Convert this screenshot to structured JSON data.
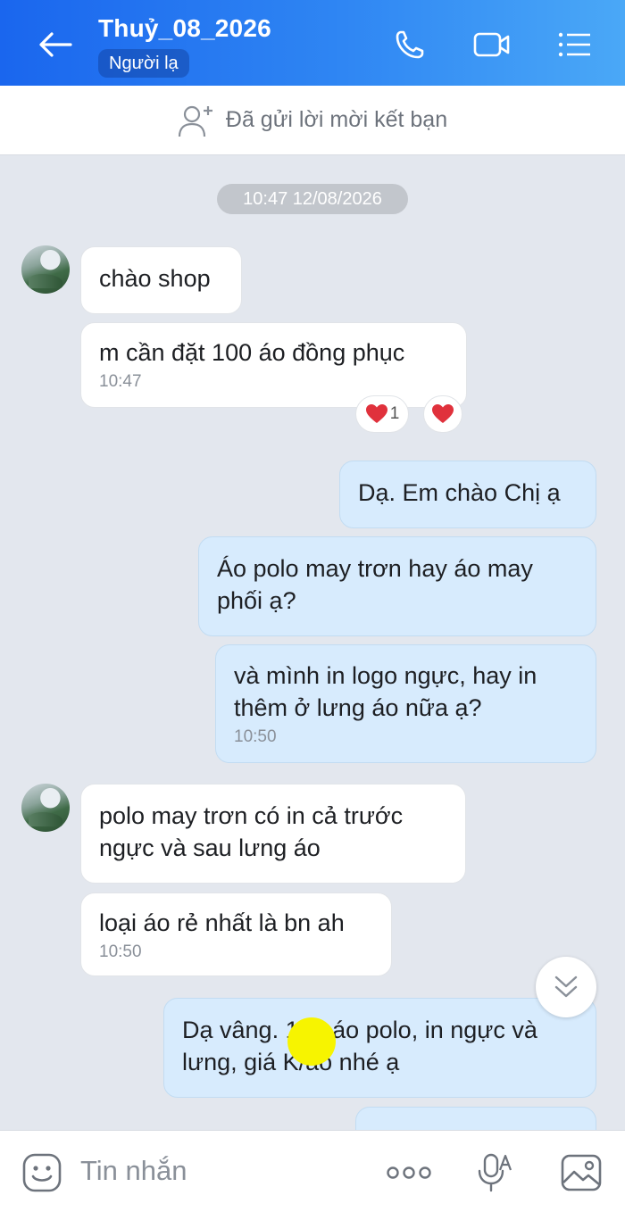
{
  "header": {
    "title": "Thuỷ_08_2026",
    "badge": "Người lạ"
  },
  "friend_request": {
    "text": "Đã gửi lời mời kết bạn"
  },
  "chat": {
    "date_divider": "10:47 12/08/2026",
    "messages": [
      {
        "side": "in",
        "text": "chào shop"
      },
      {
        "side": "in",
        "text": "m cần đặt 100 áo đồng phục",
        "time": "10:47",
        "reaction_count": "1"
      },
      {
        "side": "out",
        "text": "Dạ. Em chào Chị ạ"
      },
      {
        "side": "out",
        "text": "Áo polo may trơn hay áo may phối ạ?"
      },
      {
        "side": "out",
        "text": "và mình in logo ngực, hay in thêm ở lưng áo nữa ạ?",
        "time": "10:50"
      },
      {
        "side": "in",
        "text": "polo may trơn có in cả trước ngực và sau lưng áo"
      },
      {
        "side": "in",
        "text": "loại áo rẻ nhất là bn ah",
        "time": "10:50"
      },
      {
        "side": "out",
        "text": "Dạ vâng. 100 áo polo, in ngực và lưng, giá      K/áo nhé ạ"
      }
    ]
  },
  "input": {
    "placeholder": "Tin nhắn"
  },
  "colors": {
    "header_start": "#1a66ee",
    "header_end": "#4aa8f7",
    "outgoing_bubble": "#d7ebfd",
    "incoming_bubble": "#ffffff",
    "chat_background": "#e3e7ee",
    "reaction_heart": "#e0313c"
  },
  "icons": [
    "back-arrow-icon",
    "phone-icon",
    "video-call-icon",
    "menu-icon",
    "add-friend-icon",
    "heart-icon",
    "chevron-double-down-icon",
    "emoji-icon",
    "more-options-icon",
    "voice-text-icon",
    "gallery-icon"
  ]
}
